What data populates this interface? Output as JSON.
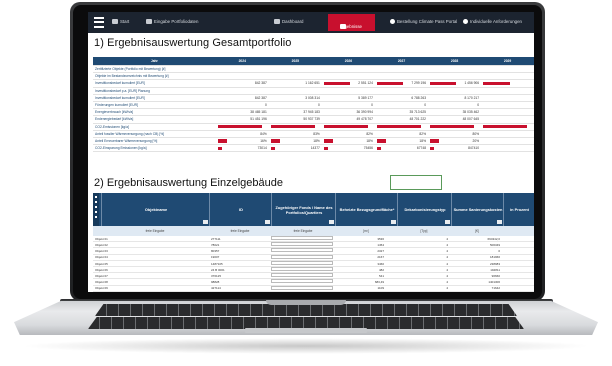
{
  "nav": {
    "start": "Start",
    "eingabe": "Eingabe Portfoliodaten",
    "dashboard": "Dashboard",
    "ergebnisse": "Ergebnisse",
    "bestellung": "Bestellung Climate Pass Portal",
    "individuell": "Individuelle Anforderungen"
  },
  "section1": {
    "title": "1) Ergebnisauswertung Gesamtportfolio",
    "year_label": "Jahr",
    "years": [
      "2024",
      "2025",
      "2026",
      "2027",
      "2028",
      "2029"
    ],
    "rows": [
      {
        "label": "Zertifizierte Objekte (Portfolio mit Bewertung) [#]",
        "values": [
          "",
          "",
          "",
          "",
          "",
          ""
        ],
        "bars": [
          0,
          0,
          0,
          0,
          0,
          0
        ]
      },
      {
        "label": "Objekte im Bestandsverzeichnis mit Bewertung [#]",
        "values": [
          "",
          "",
          "",
          "",
          "",
          ""
        ],
        "bars": [
          0,
          0,
          0,
          0,
          0,
          0
        ]
      },
      {
        "label": "Investitionsbedarf kumuliert [EUR]",
        "values": [
          "842 387",
          "1 162 651",
          "2 551 124",
          "7 299 196",
          "1 456 906",
          ""
        ],
        "bars": [
          0,
          0,
          0.6,
          0.6,
          0.6,
          0.6
        ]
      },
      {
        "label": "Investitionsbedarf p.a. [EUR] Planung",
        "values": [
          "",
          "",
          "",
          "",
          "",
          ""
        ],
        "bars": [
          0,
          0,
          0,
          0,
          0,
          0
        ]
      },
      {
        "label": "Investitionsbedarf kumuliert [EUR]",
        "values": [
          "842 387",
          "3 008 314",
          "5 389 177",
          "6 788 263",
          "8 170 217",
          ""
        ],
        "bars": [
          0,
          0,
          0,
          0,
          0,
          0
        ]
      },
      {
        "label": "Förderungen kumuliert [EUR]",
        "values": [
          "0",
          "0",
          "0",
          "0",
          "0",
          ""
        ],
        "bars": [
          0,
          0,
          0,
          0,
          0,
          0
        ]
      },
      {
        "label": "Energieverbrauch [kWh/a]",
        "values": [
          "38 465 181",
          "37 945 183",
          "36 390 994",
          "35 713 625",
          "35 035 462",
          ""
        ],
        "bars": [
          0,
          0,
          0,
          0,
          0,
          0
        ]
      },
      {
        "label": "Endenergiebedarf [kWh/a]",
        "values": [
          "51 451 196",
          "50 937 739",
          "49 478 707",
          "48 701 222",
          "48 007 645",
          ""
        ],
        "bars": [
          0,
          0,
          0,
          0,
          0,
          0
        ]
      },
      {
        "label": "CO2-Emissionen [kg/a]",
        "values": [
          "",
          "",
          "",
          "",
          "",
          ""
        ],
        "bars": [
          1,
          1,
          1,
          1,
          1,
          1
        ]
      },
      {
        "label": "Anteil fossiler Wärmeversorgung (nach CB) [%]",
        "values": [
          "84%",
          "83%",
          "82%",
          "82%",
          "80%",
          ""
        ],
        "bars": [
          0,
          0,
          0,
          0,
          0,
          0
        ]
      },
      {
        "label": "Anteil Erneuerbarer Wärmeversorgung [%]",
        "values": [
          "16%",
          "18%",
          "18%",
          "18%",
          "20%",
          ""
        ],
        "bars": [
          0.2,
          0.2,
          0.2,
          0.2,
          0.2,
          0
        ]
      },
      {
        "label": "CO2-Einsparung Emissionen [kg/a]",
        "values": [
          "73014",
          "14377",
          "75456",
          "67748",
          "847410",
          ""
        ],
        "bars": [
          0.1,
          0.1,
          0.1,
          0.1,
          0.1,
          0
        ]
      }
    ]
  },
  "section2": {
    "title": "2) Ergebnisauswertung Einzelgebäude",
    "headers": [
      "Objektname",
      "ID",
      "Zugehöriger Fonds / Name des Portfolios/Quartiers",
      "Beheizte Bezugsgrundfläche*",
      "Dekarbonisierungstyp",
      "Summe Sanierungskosten",
      "in Prozent"
    ],
    "subheaders": [
      "freie Eingabe",
      "freie Eingabe",
      "freie Eingabe",
      "[m²]",
      "[Typ]",
      "[€]",
      ""
    ],
    "rows": [
      {
        "name": "Objekt 01",
        "id": "277111",
        "area": "3536",
        "typ": "4",
        "cost": "694342,0"
      },
      {
        "name": "Objekt 02",
        "id": "78021",
        "area": "1454",
        "typ": "4",
        "cost": "506349"
      },
      {
        "name": "Objekt 03",
        "id": "80357",
        "area": "2327",
        "typ": "4",
        "cost": "0"
      },
      {
        "name": "Objekt 04",
        "id": "19007",
        "area": "2167",
        "typ": "4",
        "cost": "181966"
      },
      {
        "name": "Objekt 05",
        "id": "1487105",
        "area": "3460",
        "typ": "4",
        "cost": "238983"
      },
      {
        "name": "Objekt 06",
        "id": "24 B 0001",
        "area": "482",
        "typ": "4",
        "cost": "194811"
      },
      {
        "name": "Objekt 07",
        "id": "376125",
        "area": "541",
        "typ": "4",
        "cost": "96660"
      },
      {
        "name": "Objekt 08",
        "id": "98828",
        "area": "683,49",
        "typ": "4",
        "cost": "1401306"
      },
      {
        "name": "Objekt 09",
        "id": "427114",
        "area": "1109",
        "typ": "4",
        "cost": "71642"
      },
      {
        "name": "Objekt 10",
        "id": "278128",
        "area": "662",
        "typ": "4",
        "cost": "0"
      }
    ]
  }
}
